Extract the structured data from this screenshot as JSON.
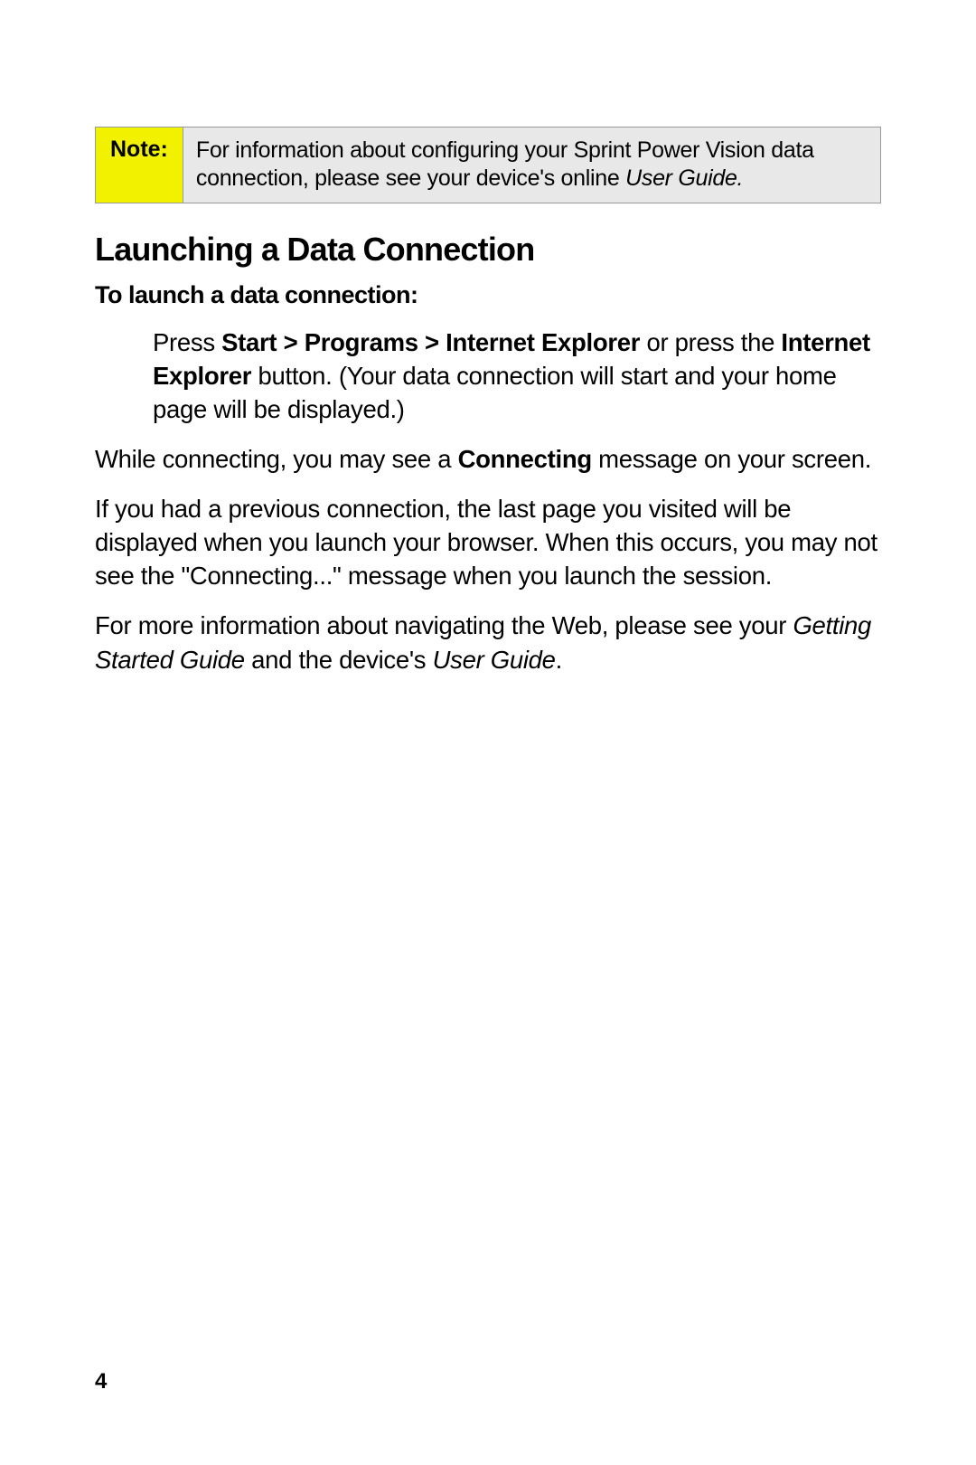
{
  "note": {
    "label": "Note:",
    "body_part1": "For information about configuring your Sprint Power Vision data connection, please see your device's online ",
    "body_italic": "User Guide."
  },
  "heading": "Launching a Data Connection",
  "subheading": "To launch a data connection:",
  "step": {
    "pre": "Press ",
    "bold1": "Start > Programs > Internet Explorer",
    "mid1": " or press the ",
    "bold2": "Internet Explorer",
    "post": " button. (Your data connection will start and your home page will be displayed.)"
  },
  "para1": {
    "pre": "While connecting, you may see a ",
    "bold": "Connecting",
    "post": " message on your screen."
  },
  "para2": "If you had a previous connection, the last page you visited will be displayed when you launch your browser. When this occurs, you may not see the \"Connecting...\" message when you launch the session.",
  "para3": {
    "pre": "For more information about navigating the Web, please see your ",
    "italic1": "Getting Started Guide",
    "mid": " and the device's ",
    "italic2": "User Guide",
    "post": "."
  },
  "pageNumber": "4"
}
